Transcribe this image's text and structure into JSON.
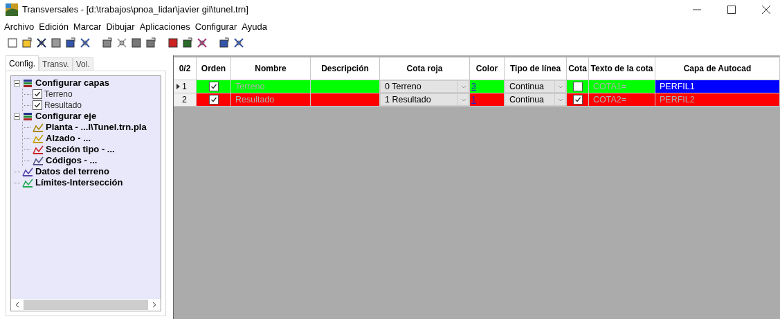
{
  "window": {
    "title": "Transversales - [d:\\trabajos\\pnoa_lidar\\javier gil\\tunel.trn]"
  },
  "menu": [
    "Archivo",
    "Edición",
    "Marcar",
    "Dibujar",
    "Aplicaciones",
    "Configurar",
    "Ayuda"
  ],
  "tabs": [
    {
      "label": "Config.",
      "selected": true
    },
    {
      "label": "Transv.",
      "selected": false
    },
    {
      "label": "Vol.",
      "selected": false
    }
  ],
  "tree": [
    {
      "label": "Configurar capas",
      "kind": "group",
      "expanded": true,
      "children": [
        {
          "label": "Terreno",
          "kind": "checkbox",
          "checked": true
        },
        {
          "label": "Resultado",
          "kind": "checkbox",
          "checked": true
        }
      ]
    },
    {
      "label": "Configurar eje",
      "kind": "group",
      "expanded": true,
      "children": [
        {
          "label": "Planta - ...l\\Tunel.trn.pla",
          "kind": "item"
        },
        {
          "label": "Alzado - ...",
          "kind": "item"
        },
        {
          "label": "Sección tipo - ...",
          "kind": "item"
        },
        {
          "label": "Códigos - ...",
          "kind": "item"
        }
      ]
    },
    {
      "label": "Datos del terreno",
      "kind": "item"
    },
    {
      "label": "Límites-Intersección",
      "kind": "item"
    }
  ],
  "table": {
    "corner": "0/2",
    "columns": [
      "Orden",
      "Nombre",
      "Descripción",
      "Cota roja",
      "Color",
      "Tipo de línea",
      "Cota",
      "Texto de la cota",
      "Capa de Autocad"
    ],
    "rows": [
      {
        "index": "1",
        "current": true,
        "color": "#00ff00",
        "orden": true,
        "nombre": "Terreno",
        "descripcion": "",
        "cota_roja": "0 Terreno",
        "color_value": "3",
        "tipo_linea": "Continua",
        "cota": false,
        "texto": "COTA1=",
        "capa": "PERFIL1",
        "capa_selected": true
      },
      {
        "index": "2",
        "current": false,
        "color": "#ff0000",
        "orden": true,
        "nombre": "Resultado",
        "descripcion": "",
        "cota_roja": "1 Resultado",
        "color_value": "1",
        "tipo_linea": "Continua",
        "cota": true,
        "texto": "COTA2=",
        "capa": "PERFIL2",
        "capa_selected": false
      }
    ]
  }
}
